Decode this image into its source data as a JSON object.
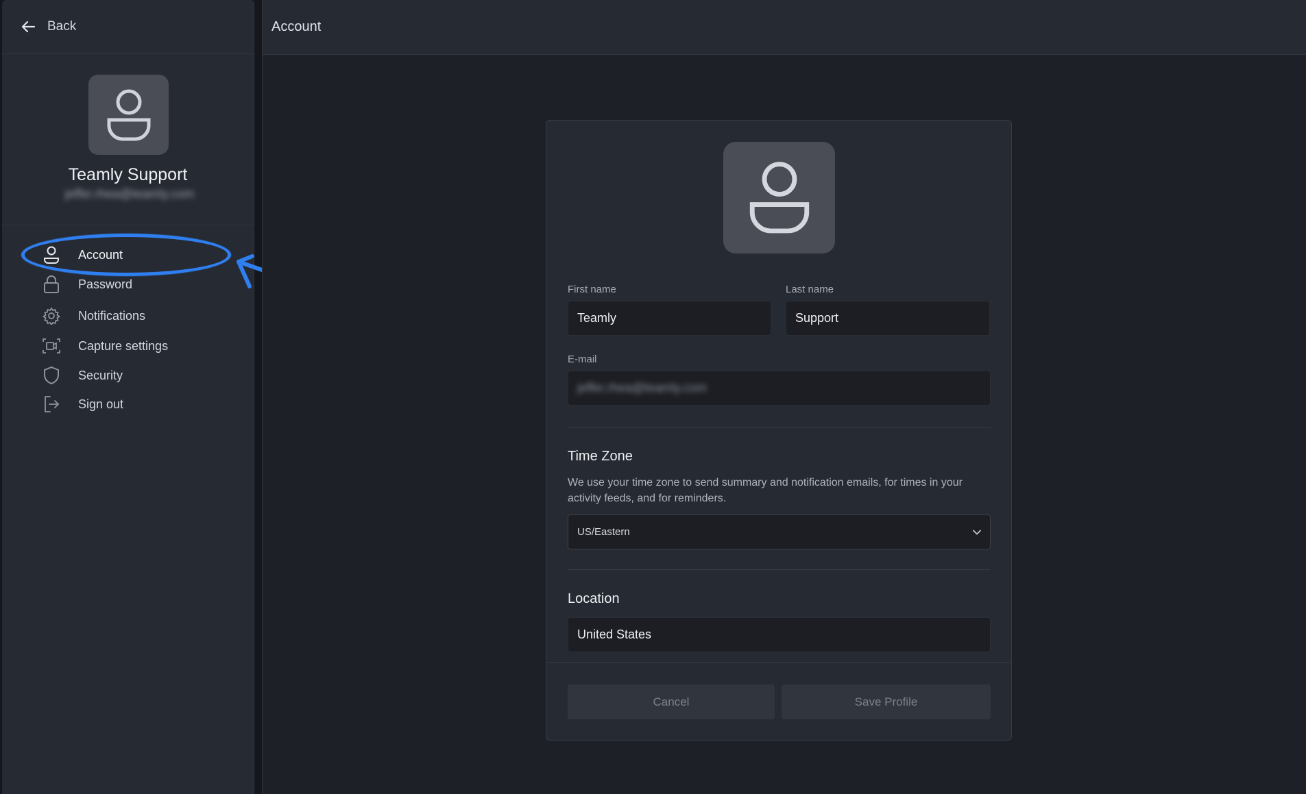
{
  "sidebar": {
    "back_label": "Back",
    "profile": {
      "name": "Teamly Support",
      "email": "jeffer.rhea@teamly.com"
    },
    "items": [
      {
        "label": "Account",
        "icon": "person-icon"
      },
      {
        "label": "Password",
        "icon": "lock-icon"
      },
      {
        "label": "Notifications",
        "icon": "gear-icon"
      },
      {
        "label": "Capture settings",
        "icon": "screen-capture-icon"
      },
      {
        "label": "Security",
        "icon": "shield-icon"
      },
      {
        "label": "Sign out",
        "icon": "sign-out-icon"
      }
    ],
    "active_item": "Account"
  },
  "header": {
    "title": "Account"
  },
  "form": {
    "first_name": {
      "label": "First name",
      "value": "Teamly"
    },
    "last_name": {
      "label": "Last name",
      "value": "Support"
    },
    "email": {
      "label": "E-mail",
      "value": "jeffer.rhea@teamly.com"
    },
    "timezone": {
      "title": "Time Zone",
      "description": "We use your time zone to send summary and notification emails, for times in your activity feeds, and for reminders.",
      "selected": "US/Eastern"
    },
    "location": {
      "title": "Location",
      "value": "United States"
    },
    "cancel_label": "Cancel",
    "save_label": "Save Profile"
  },
  "colors": {
    "annotation": "#2f7ff0",
    "sidebar_bg": "#262a33",
    "main_bg": "#1d2027",
    "input_bg": "#1c1e24"
  }
}
